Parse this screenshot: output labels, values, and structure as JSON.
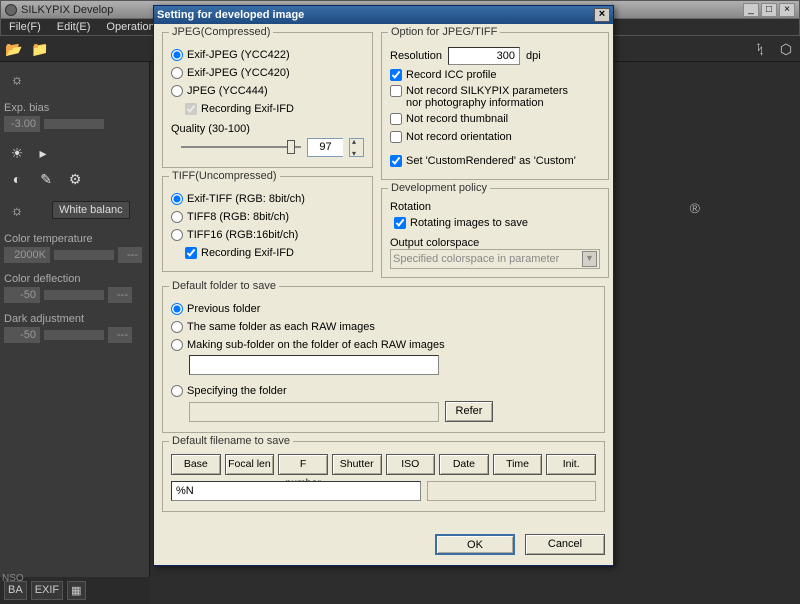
{
  "app": {
    "title": "SILKYPIX Develop"
  },
  "menu": {
    "file": "File(F)",
    "edit": "Edit(E)",
    "operation": "Operation"
  },
  "main_win_controls": {
    "min": "_",
    "max": "□",
    "close": "×"
  },
  "left_panel": {
    "exp_label": "Exp. bias",
    "exp_value": "-3.00",
    "tab": "White balanc",
    "ct_label": "Color temperature",
    "ct_value": "2000K",
    "ct_dashes": "---",
    "cd_label": "Color deflection",
    "cd_value": "-50",
    "cd_dashes": "---",
    "da_label": "Dark adjustment",
    "da_value": "-50",
    "da_dashes": "---"
  },
  "bottom": {
    "ba": "BA",
    "exif": "EXIF",
    "thumb": "▦"
  },
  "nso": "NSO",
  "dialog": {
    "title": "Setting for developed image",
    "close": "×",
    "jpeg": {
      "group": "JPEG(Compressed)",
      "opt1": "Exif-JPEG  (YCC422)",
      "opt2": "Exif-JPEG  (YCC420)",
      "opt3": "JPEG  (YCC444)",
      "rec_exif": "Recording Exif-IFD",
      "quality_label": "Quality (30-100)",
      "quality_value": "97"
    },
    "tiff": {
      "group": "TIFF(Uncompressed)",
      "opt1": "Exif-TIFF  (RGB: 8bit/ch)",
      "opt2": "TIFF8   (RGB: 8bit/ch)",
      "opt3": "TIFF16  (RGB:16bit/ch)",
      "rec_exif": "Recording Exif-IFD"
    },
    "option": {
      "group": "Option for JPEG/TIFF",
      "res_label": "Resolution",
      "res_value": "300",
      "res_unit": "dpi",
      "rec_icc": "Record ICC profile",
      "not_rec_params": "Not record SILKYPIX parameters nor photography information",
      "not_rec_thumb": "Not record thumbnail",
      "not_rec_orient": "Not record orientation",
      "set_custom": "Set 'CustomRendered' as 'Custom'"
    },
    "devpolicy": {
      "group": "Development policy",
      "rotation_label": "Rotation",
      "rotating": "Rotating images to save",
      "output_cs_label": "Output colorspace",
      "output_cs_value": "Specified colorspace in parameter"
    },
    "folder": {
      "group": "Default folder to save",
      "prev": "Previous folder",
      "same": "The same folder as each RAW images",
      "subfolder": "Making sub-folder on the folder of each RAW images",
      "specify": "Specifying the folder",
      "refer": "Refer"
    },
    "filename": {
      "group": "Default filename to save",
      "base": "Base",
      "focal": "Focal len",
      "fnum": "F number",
      "shutter": "Shutter",
      "iso": "ISO",
      "date": "Date",
      "time": "Time",
      "init": "Init.",
      "pattern": "%N"
    },
    "ok": "OK",
    "cancel": "Cancel"
  }
}
